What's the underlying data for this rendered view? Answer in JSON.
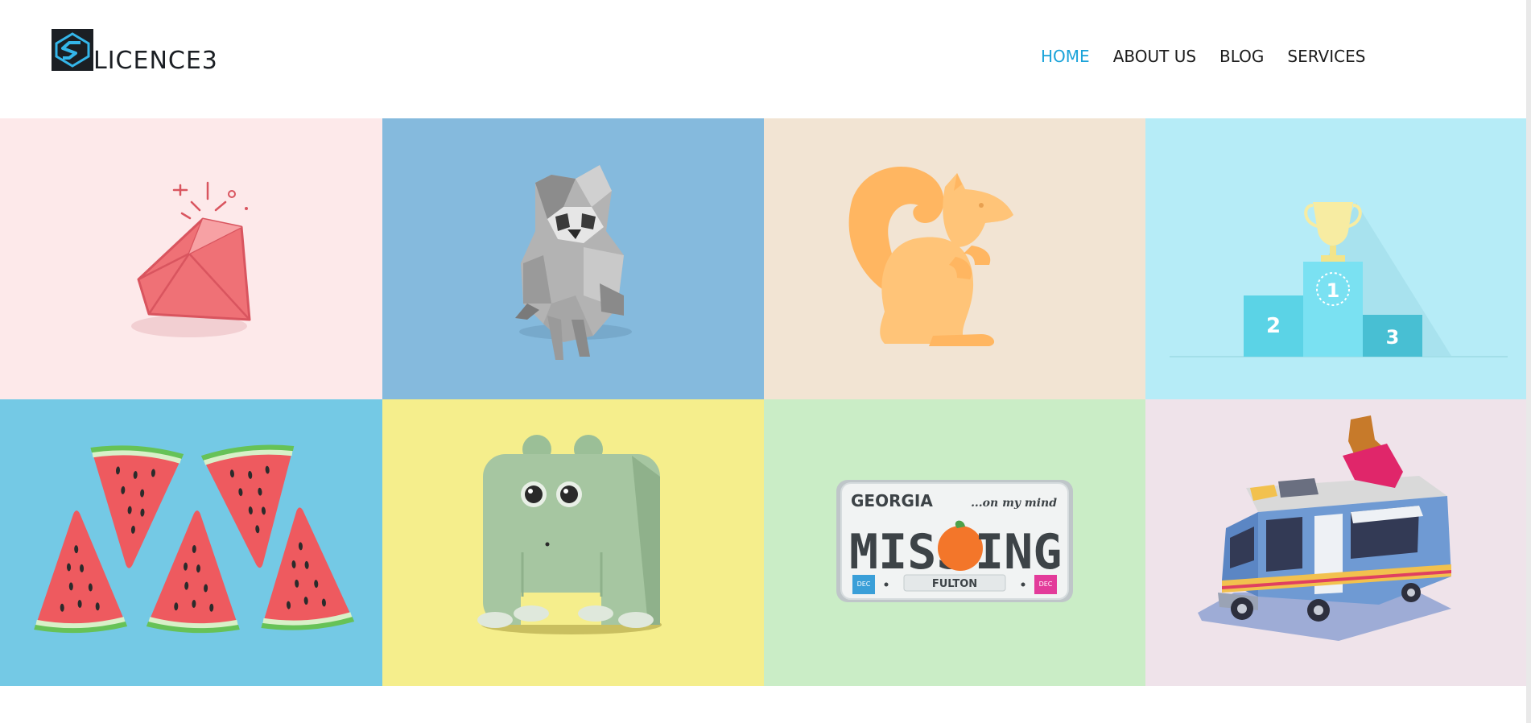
{
  "header": {
    "logo_text": "LICENCE3",
    "nav": [
      {
        "label": "HOME",
        "active": true
      },
      {
        "label": "ABOUT US",
        "active": false
      },
      {
        "label": "BLOG",
        "active": false
      },
      {
        "label": "SERVICES",
        "active": false
      }
    ]
  },
  "colors": {
    "accent": "#1aa3d9",
    "nav_text": "#1c1c1c"
  },
  "portfolio": {
    "tiles": [
      {
        "name": "ruby-gem",
        "bg": "#fde9ea"
      },
      {
        "name": "raccoon",
        "bg": "#85badd"
      },
      {
        "name": "squirrel",
        "bg": "#f2e4d3"
      },
      {
        "name": "podium",
        "bg": "#b6ecf7"
      },
      {
        "name": "watermelon",
        "bg": "#74c9e5"
      },
      {
        "name": "green-monster",
        "bg": "#f5ee8c"
      },
      {
        "name": "license-plate",
        "bg": "#caedc6"
      },
      {
        "name": "food-truck",
        "bg": "#efe3ea"
      }
    ],
    "plate": {
      "state": "GEORGIA",
      "slogan": "...on my mind",
      "text_left": "MISS",
      "text_right": "ING",
      "county": "FULTON",
      "sticker": "DEC"
    },
    "podium": {
      "first": "1",
      "second": "2",
      "third": "3"
    }
  }
}
